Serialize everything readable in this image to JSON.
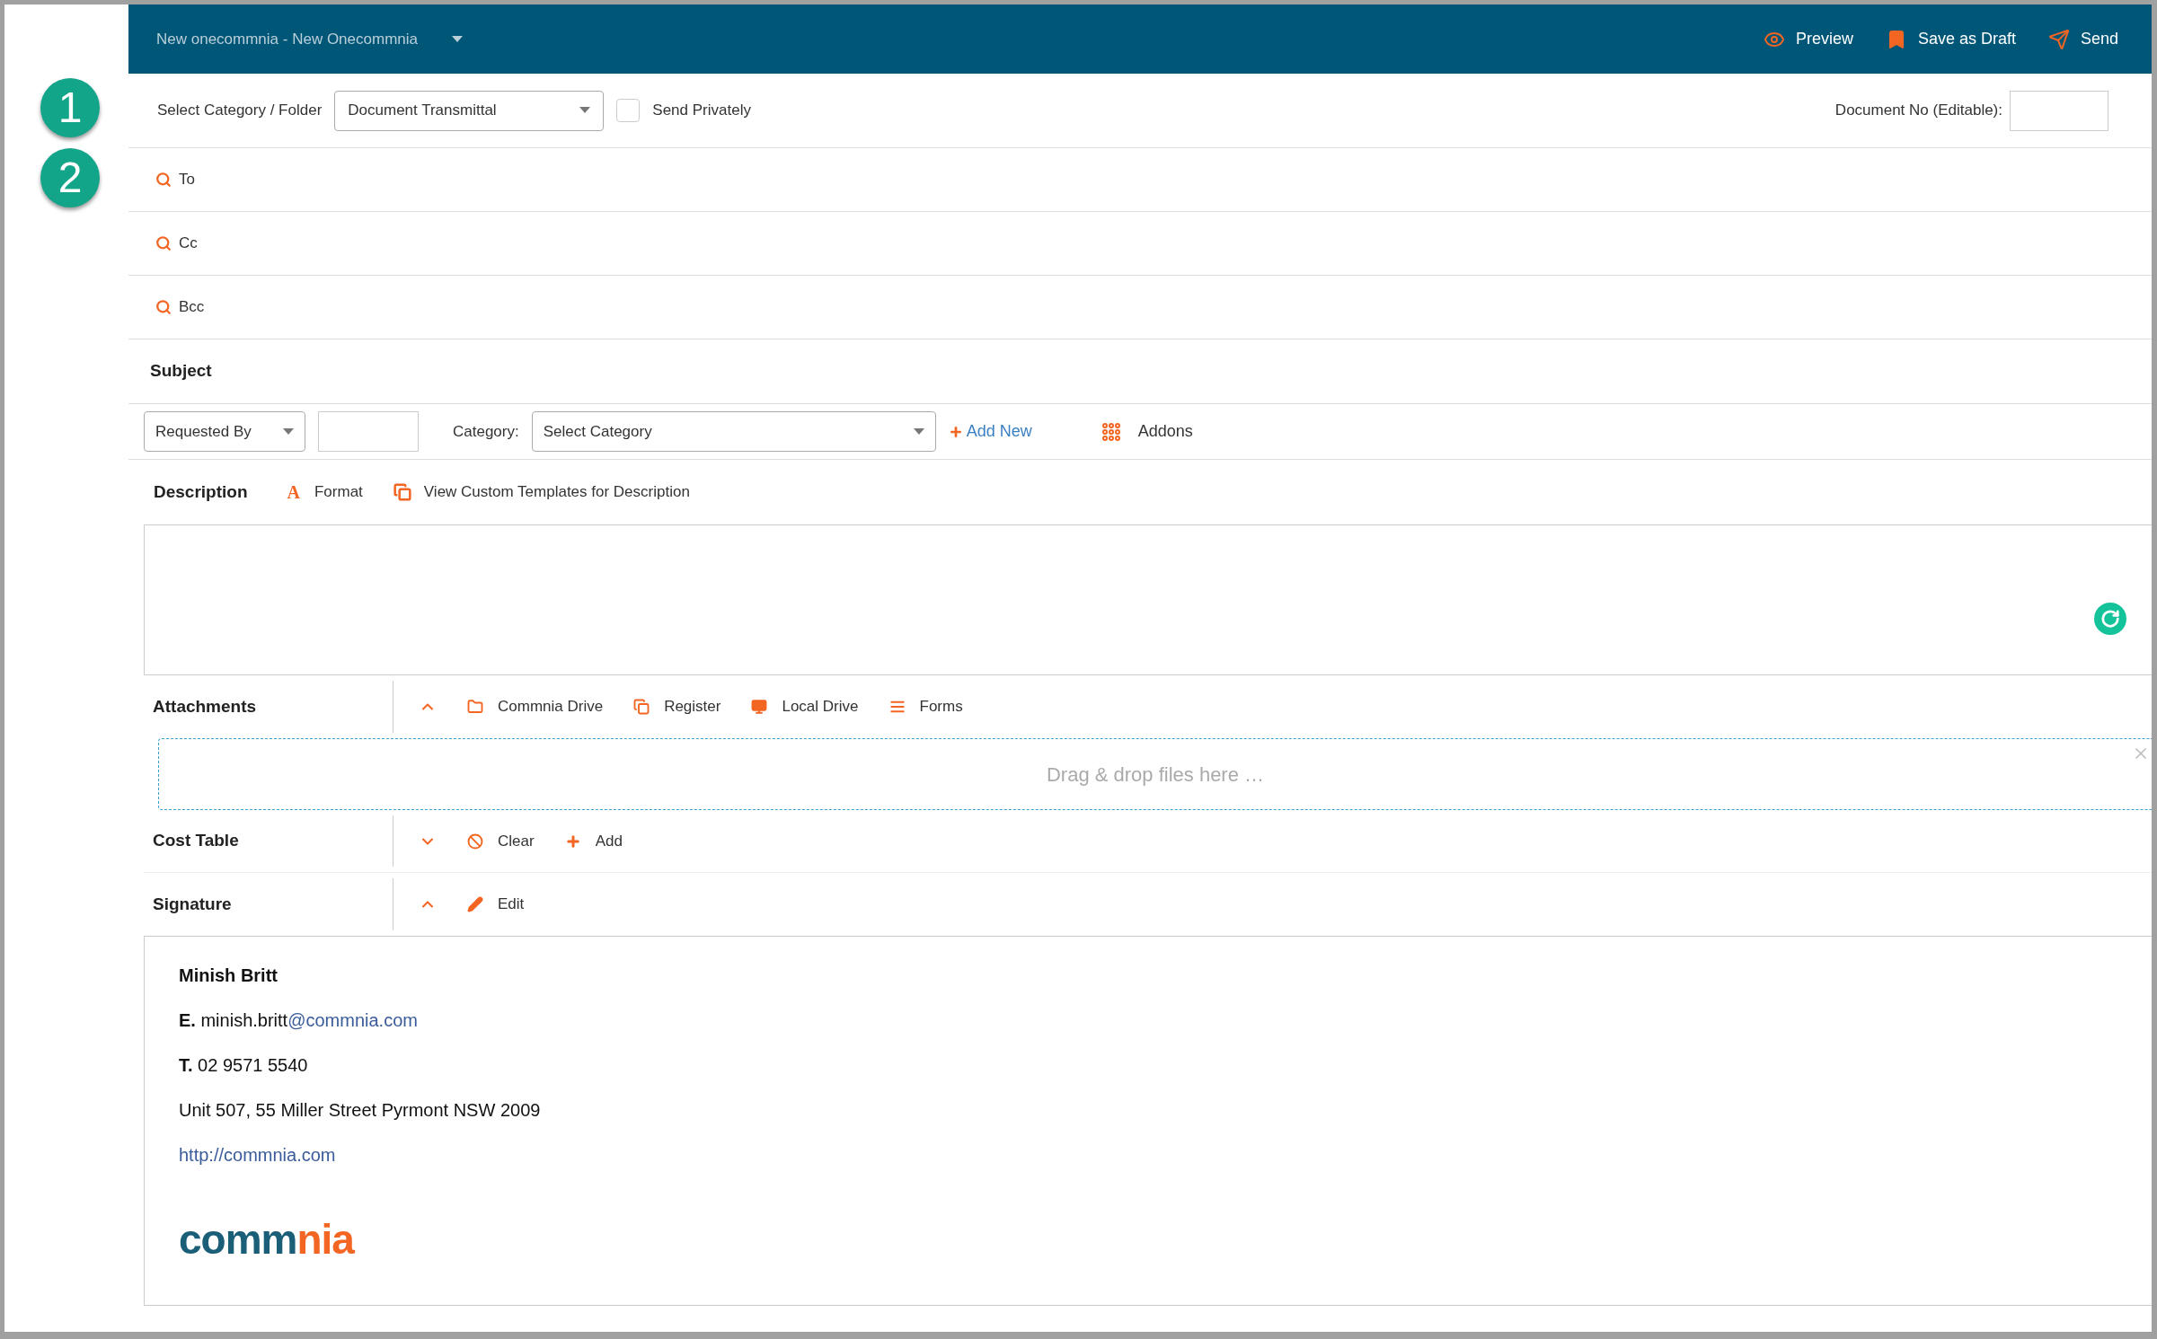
{
  "header": {
    "title": "New onecommnia - New Onecommnia",
    "actions": [
      {
        "kind": "preview",
        "label": "Preview"
      },
      {
        "kind": "draft",
        "label": "Save as Draft"
      },
      {
        "kind": "send",
        "label": "Send"
      }
    ]
  },
  "steps": [
    "1",
    "2"
  ],
  "category_row": {
    "label": "Select Category / Folder",
    "value": "Document Transmittal",
    "private": {
      "label": "Send Privately",
      "checked": false
    },
    "doc_no_label": "Document No (Editable):"
  },
  "recipients": [
    {
      "label": "To"
    },
    {
      "label": "Cc"
    },
    {
      "label": "Bcc"
    }
  ],
  "subject": {
    "label": "Subject"
  },
  "meta_row": {
    "requested_by": "Requested By",
    "category_label": "Category:",
    "category_value": "Select Category",
    "add_new": "Add New",
    "addons": "Addons"
  },
  "description": {
    "label": "Description",
    "format_icon": "A",
    "format": "Format",
    "templates": "View Custom Templates for Description"
  },
  "sections": [
    {
      "kind": "attachments",
      "label": "Attachments",
      "expanded": true,
      "actions": [
        {
          "kind": "folder",
          "label": "Commnia Drive"
        },
        {
          "kind": "register",
          "label": "Register"
        },
        {
          "kind": "monitor",
          "label": "Local Drive"
        },
        {
          "kind": "forms",
          "label": "Forms"
        }
      ],
      "drop_text": "Drag & drop files here …"
    },
    {
      "kind": "cost",
      "label": "Cost Table",
      "expanded": false,
      "actions": [
        {
          "kind": "clear",
          "label": "Clear"
        },
        {
          "kind": "add",
          "label": "Add"
        }
      ]
    },
    {
      "kind": "signature",
      "label": "Signature",
      "expanded": true,
      "actions": [
        {
          "kind": "edit",
          "label": "Edit"
        }
      ]
    }
  ],
  "signature": {
    "name": "Minish Britt",
    "email": "**E.** minish.britt",
    "email_link": "@commnia.com",
    "phone": "**T.** 02 9571 5540",
    "address": "Unit 507, 55 Miller Street Pyrmont NSW 2009",
    "website": "http://commnia.com",
    "logo": [
      "comm",
      "nia"
    ]
  }
}
